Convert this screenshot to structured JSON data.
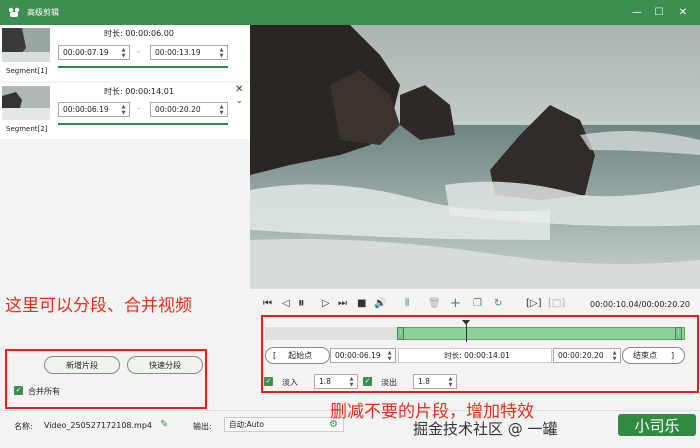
{
  "window": {
    "title": "高级剪辑",
    "min": "—",
    "max": "☐",
    "close": "✕"
  },
  "segments": [
    {
      "label": "Segment[1]",
      "duration_label": "时长:",
      "duration": "00:00:06.00",
      "start": "00:00:07.19",
      "end": "00:00:13.19"
    },
    {
      "label": "Segment[2]",
      "duration_label": "时长:",
      "duration": "00:00:14.01",
      "start": "00:00:06.19",
      "end": "00:00:20.20"
    }
  ],
  "annotations": {
    "left": "这里可以分段、合并视频",
    "right": "删减不要的片段，增加特效"
  },
  "buttons": {
    "add_segment": "新增片段",
    "quick_split": "快速分段",
    "merge_all": "合并所有"
  },
  "player": {
    "time": "00:00:10.04/00:00:20.20"
  },
  "range": {
    "start_label": "起始点",
    "start": "00:00:06.19",
    "duration_label": "时长:",
    "duration": "00:00:14.01",
    "end": "00:00:20.20",
    "end_label": "结束点",
    "bracket_open": "[",
    "bracket_close": "]"
  },
  "effects": {
    "fade_in_label": "淡入",
    "fade_in": "1.8",
    "fade_out_label": "淡出",
    "fade_out": "1.8"
  },
  "bottom": {
    "name_label": "名称:",
    "filename": "Video_250527172108.mp4",
    "output_label": "输出:",
    "output_value": "自动;Auto"
  },
  "watermark": {
    "text": "掘金技术社区 @ 一罐",
    "badge": "小司乐"
  },
  "colors": {
    "accent": "#3e8e52",
    "annotation": "#e0301e"
  }
}
